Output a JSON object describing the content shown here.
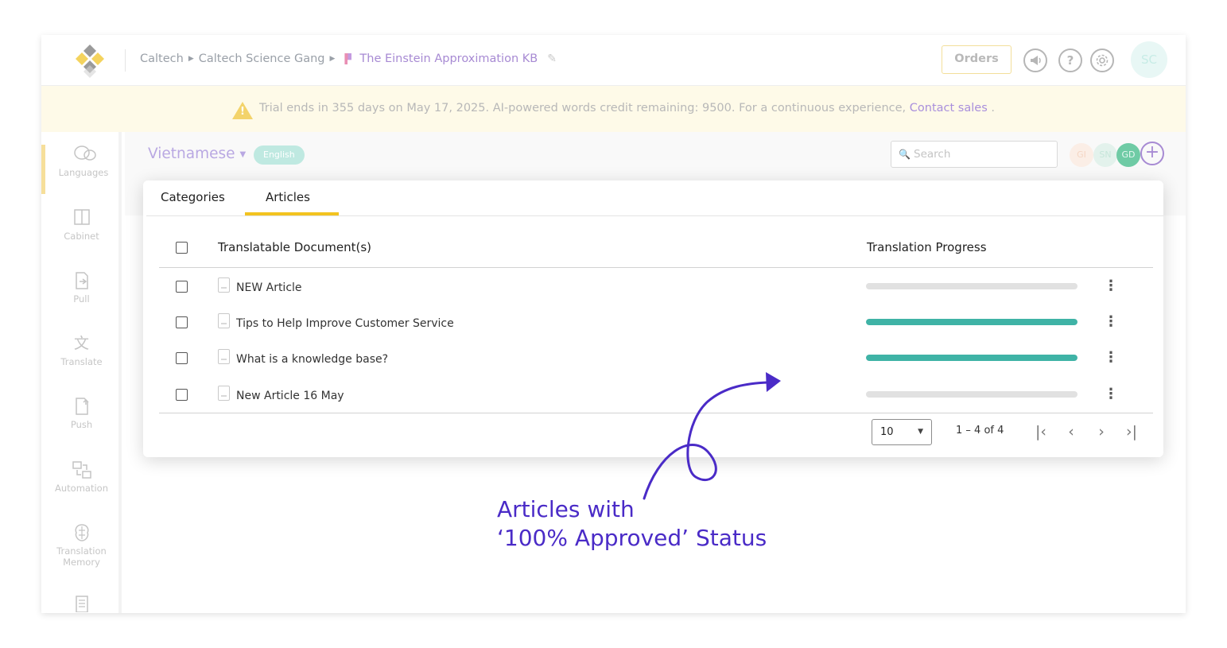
{
  "header": {
    "breadcrumb": [
      "Caltech",
      "Caltech Science Gang",
      "The Einstein Approximation KB"
    ],
    "orders_label": "Orders",
    "icons": [
      "megaphone-icon",
      "help-icon",
      "gear-icon"
    ],
    "help_glyph": "?",
    "user_initials": "SC"
  },
  "banner": {
    "message": "Trial ends in 355 days on May 17, 2025. AI-powered words credit remaining: 9500. For a continuous experience, ",
    "link": "Contact sales",
    "suffix": " ."
  },
  "sidebar": {
    "items": [
      {
        "label": "Languages",
        "icon": "languages-icon",
        "active": true
      },
      {
        "label": "Cabinet",
        "icon": "cabinet-icon"
      },
      {
        "label": "Pull",
        "icon": "pull-icon"
      },
      {
        "label": "Translate",
        "icon": "translate-icon"
      },
      {
        "label": "Push",
        "icon": "push-icon"
      },
      {
        "label": "Automation",
        "icon": "automation-icon"
      },
      {
        "label": "Translation Memory",
        "icon": "translation-memory-icon"
      }
    ]
  },
  "toolbar": {
    "language": "Vietnamese",
    "source_language": "English",
    "search_placeholder": "Search",
    "members": [
      "GI",
      "SN",
      "GD"
    ]
  },
  "tabs": [
    "Categories",
    "Articles"
  ],
  "active_tab": "Articles",
  "table": {
    "columns": [
      "Translatable Document(s)",
      "Translation Progress"
    ],
    "rows": [
      {
        "title": "NEW Article",
        "progress": 0
      },
      {
        "title": "Tips to Help Improve Customer Service",
        "progress": 100
      },
      {
        "title": "What is a knowledge base?",
        "progress": 100
      },
      {
        "title": "New Article 16 May",
        "progress": 0
      }
    ]
  },
  "pagination": {
    "page_size": "10",
    "range": "1 – 4 of 4"
  },
  "annotation": {
    "line1": "Articles with",
    "line2": "‘100% Approved’ Status"
  },
  "colors": {
    "accent": "#f2c31f",
    "progress_complete": "#3fb3a6",
    "progress_empty": "#e1e1e1",
    "annotation": "#4a2bc7",
    "link": "#a98fdc"
  }
}
